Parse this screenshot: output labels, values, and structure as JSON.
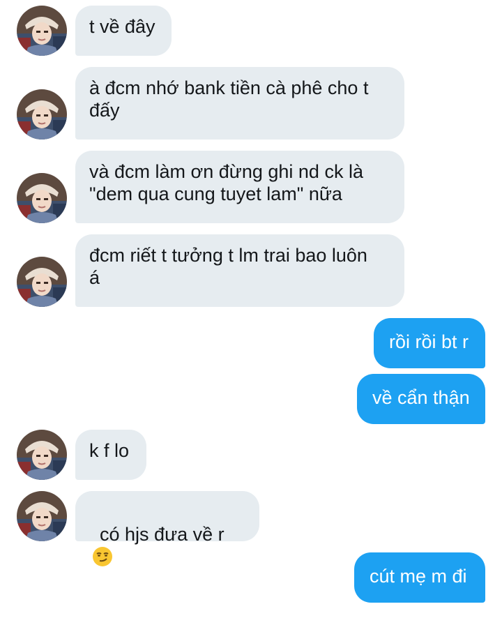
{
  "conversation": {
    "messages": [
      {
        "side": "received",
        "text": "t về đây"
      },
      {
        "side": "received",
        "text": "à đcm nhớ bank tiền cà phê cho t\nđấy"
      },
      {
        "side": "received",
        "text": "và đcm làm ơn đừng ghi nd ck là\n\"dem qua cung tuyet lam\" nữa"
      },
      {
        "side": "received",
        "text": "đcm riết t tưởng t lm trai bao luôn\ná"
      },
      {
        "side": "sent",
        "text": "rồi rồi bt r"
      },
      {
        "side": "sent",
        "text": "về cẩn thận"
      },
      {
        "side": "received",
        "text": "k f lo"
      },
      {
        "side": "received",
        "text": "có hjs đưa về r",
        "emoji": "smirking-face"
      },
      {
        "side": "sent",
        "text": "cút mẹ m đi"
      }
    ]
  },
  "colors": {
    "received_bubble": "#e6ecf0",
    "sent_bubble": "#1da1f2",
    "received_text": "#14171a",
    "sent_text": "#ffffff"
  }
}
